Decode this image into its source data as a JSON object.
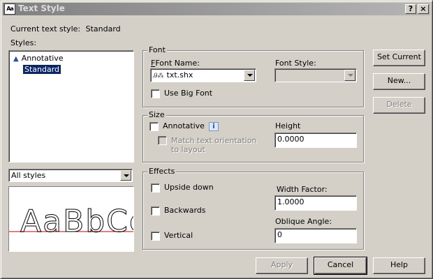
{
  "window": {
    "title": "Text Style",
    "help_button": "?",
    "close_button": "×",
    "app_icon": "autocad-text-icon"
  },
  "current_style": {
    "label": "Current text style:",
    "value": "Standard"
  },
  "styles": {
    "label": "Styles:",
    "items": [
      {
        "label": "Annotative",
        "icon": "annotative-triangle-icon",
        "selected": false
      },
      {
        "label": "Standard",
        "selected": true
      }
    ],
    "filter_selected": "All styles"
  },
  "preview": {
    "sample_text": "AaBbCc",
    "baseline_color": "#c00000"
  },
  "font": {
    "group_title": "Font",
    "font_name_label": "Font Name:",
    "font_name_value": "txt.shx",
    "font_name_icon": "shx-font-icon",
    "font_style_label": "Font Style:",
    "font_style_value": "",
    "use_big_font_label": "Use Big Font",
    "use_big_font_checked": false
  },
  "size": {
    "group_title": "Size",
    "annotative_label": "Annotative",
    "annotative_checked": false,
    "match_orientation_line1": "Match text orientation",
    "match_orientation_line2": "to layout",
    "height_label": "Height",
    "height_value": "0.0000"
  },
  "effects": {
    "group_title": "Effects",
    "upside_down_label": "Upside down",
    "backwards_label": "Backwards",
    "vertical_label": "Vertical",
    "width_factor_label": "Width Factor:",
    "width_factor_value": "1.0000",
    "oblique_angle_label": "Oblique Angle:",
    "oblique_angle_value": "0"
  },
  "buttons": {
    "set_current": "Set Current",
    "new": "New...",
    "delete": "Delete",
    "apply": "Apply",
    "cancel": "Cancel",
    "help": "Help"
  },
  "colors": {
    "dialog_bg": "#d4d0c8",
    "selection_bg": "#0a246a",
    "titlebar_inactive": "#808080"
  }
}
